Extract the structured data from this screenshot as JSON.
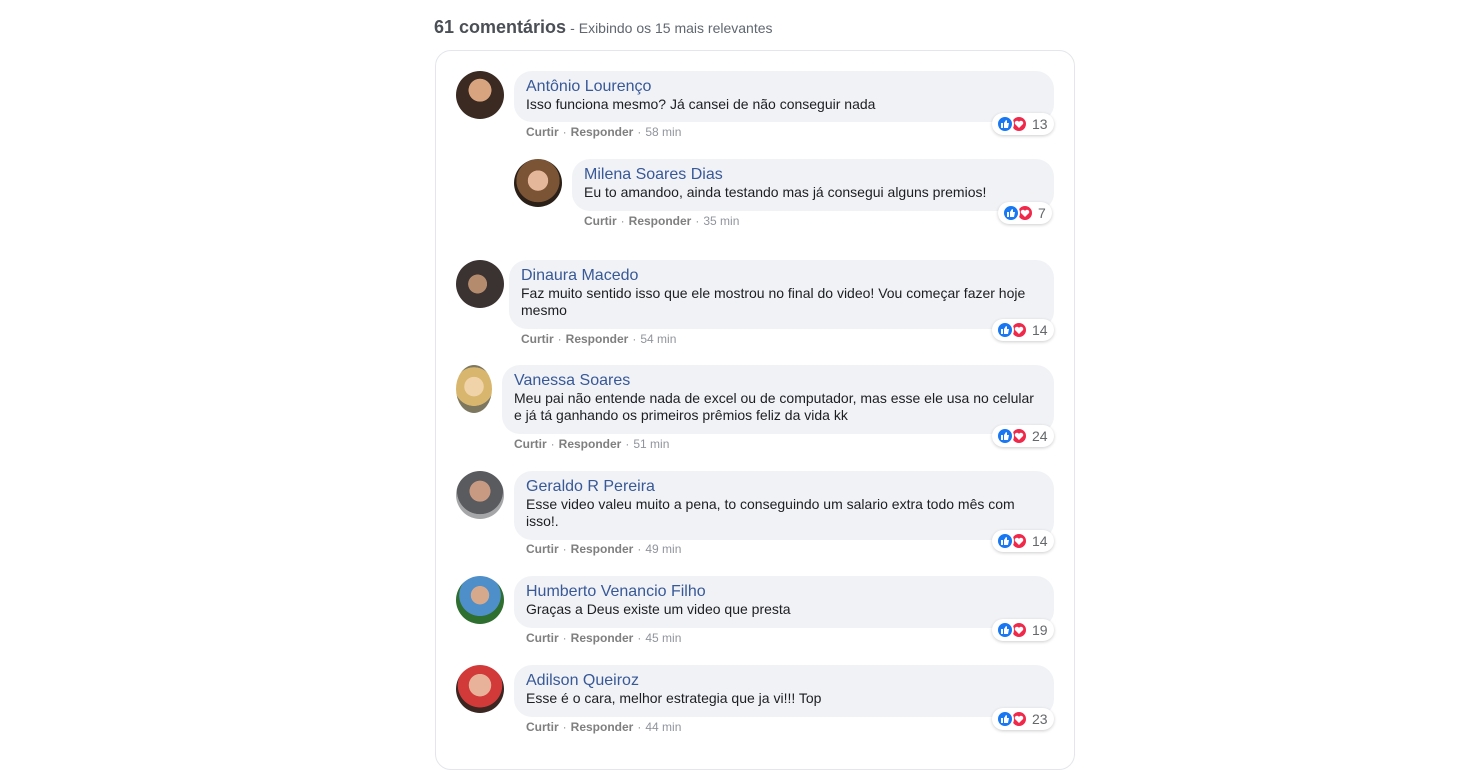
{
  "header": {
    "count": "61 comentários",
    "separator": "-",
    "subtitle": "Exibindo os 15 mais relevantes"
  },
  "actions": {
    "like": "Curtir",
    "reply": "Responder",
    "dot": "·"
  },
  "comments": [
    {
      "author": "Antônio Lourenço",
      "text": "Isso funciona mesmo? Já cansei de não conseguir nada",
      "time": "58 min",
      "reactions": "13"
    },
    {
      "author": "Milena Soares Dias",
      "text": "Eu to amandoo, ainda testando mas já consegui alguns premios!",
      "time": "35 min",
      "reactions": "7"
    },
    {
      "author": "Dinaura Macedo",
      "text": "Faz muito sentido isso que ele mostrou no final do video! Vou começar fazer hoje mesmo",
      "time": "54 min",
      "reactions": "14"
    },
    {
      "author": "Vanessa Soares",
      "text": "Meu pai não entende nada de excel ou de computador, mas esse ele usa no celular e já tá ganhando os primeiros prêmios feliz da vida kk",
      "time": "51 min",
      "reactions": "24"
    },
    {
      "author": "Geraldo R Pereira",
      "text": "Esse video valeu muito a pena, to conseguindo um salario extra todo mês com isso!.",
      "time": "49 min",
      "reactions": "14"
    },
    {
      "author": "Humberto Venancio Filho",
      "text": "Graças a Deus existe um video que presta",
      "time": "45 min",
      "reactions": "19"
    },
    {
      "author": "Adilson Queiroz",
      "text": "Esse é o cara, melhor estrategia que ja vi!!! Top",
      "time": "44 min",
      "reactions": "23"
    }
  ],
  "colors": {
    "author": "#385898",
    "bubble": "#f0f2f5",
    "like": "#1877f2",
    "love": "#f02849"
  },
  "icons": [
    "like-icon",
    "love-icon"
  ]
}
